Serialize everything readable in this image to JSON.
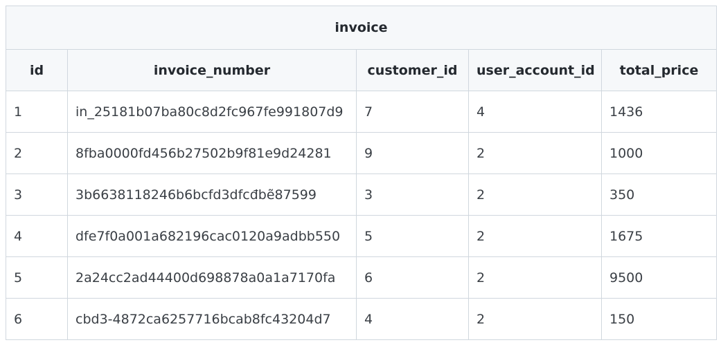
{
  "table": {
    "title": "invoice",
    "headers": [
      "id",
      "invoice_number",
      "customer_id",
      "user_account_id",
      "total_price"
    ],
    "rows": [
      [
        "1",
        "in_25181b07ba80c8d2fc967fe991807d9",
        "7",
        "4",
        "1436"
      ],
      [
        "2",
        "8fba0000fd456b27502b9f81e9d24281",
        "9",
        "2",
        "1000"
      ],
      [
        "3",
        "3b6638118246b6bcfd3dfcđbẽ87599",
        "3",
        "2",
        "350"
      ],
      [
        "4",
        "dfe7f0a001a682196cac0120a9adbb550",
        "5",
        "2",
        "1675"
      ],
      [
        "5",
        "2a24cc2ad44400d698878a0a1a7170fa",
        "6",
        "2",
        "9500"
      ],
      [
        "6",
        "cbd3-4872ca6257716bcab8fc43204d7",
        "4",
        "2",
        "150"
      ]
    ]
  }
}
